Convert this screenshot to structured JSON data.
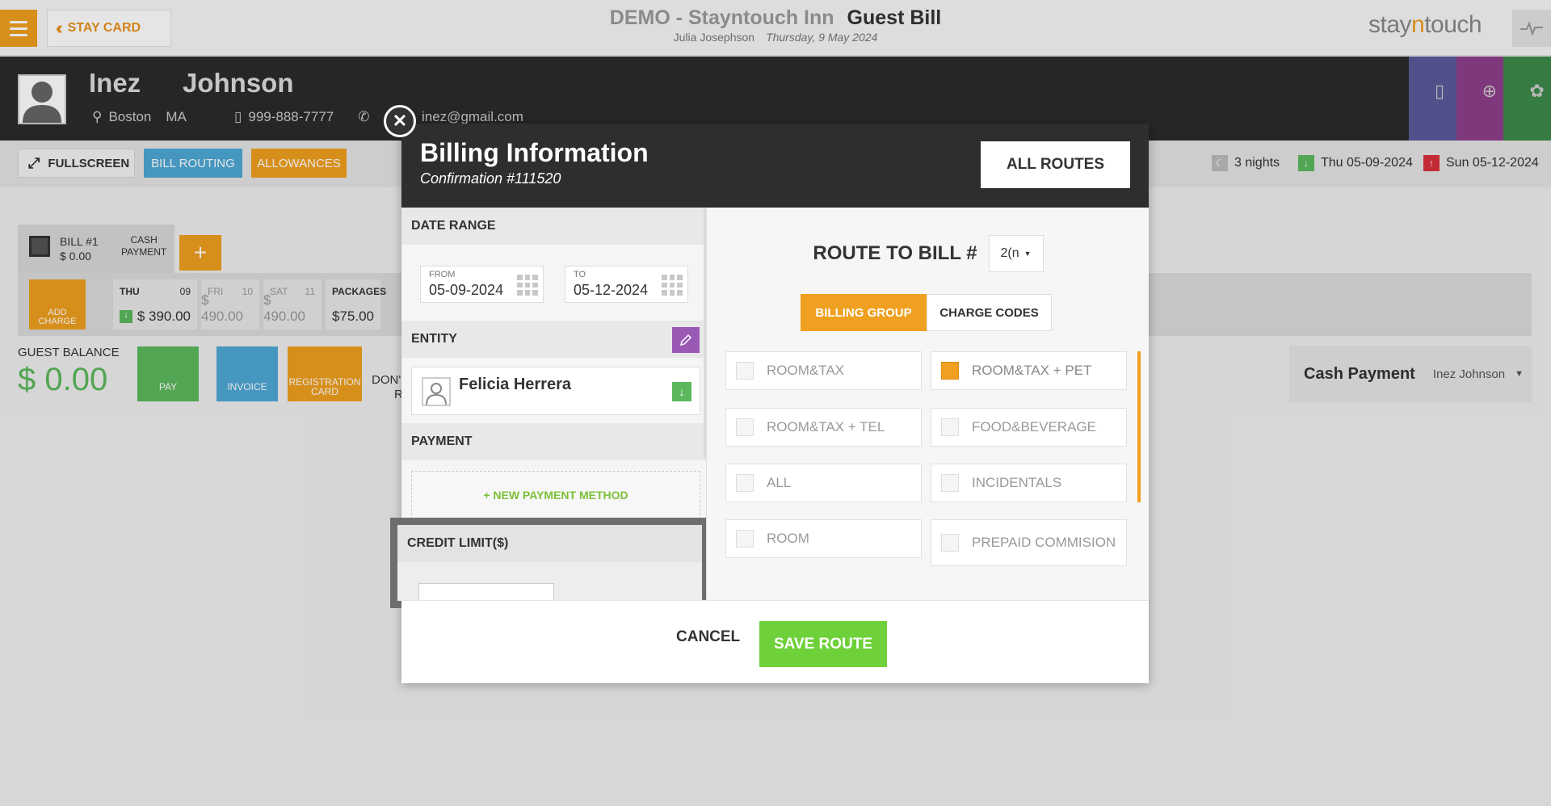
{
  "topbar": {
    "staycard_label": "STAY CARD",
    "hotel": "DEMO - Stayntouch Inn",
    "page": "Guest Bill",
    "user": "Julia Josephson",
    "date": "Thursday, 9 May 2024",
    "logo_a": "stay",
    "logo_b": "n",
    "logo_c": "touch"
  },
  "guest": {
    "first": "Inez",
    "last": "Johnson",
    "city": "Boston",
    "state": "MA",
    "phone": "999-888-7777",
    "email": "inez@gmail.com"
  },
  "subbar": {
    "fullscreen": "FULLSCREEN",
    "bill_routing": "BILL ROUTING",
    "allowances": "ALLOWANCES",
    "nights": "3 nights",
    "arrival": "Thu 05-09-2024",
    "departure": "Sun 05-12-2024"
  },
  "bill": {
    "label": "BILL #1",
    "amount": "$ 0.00",
    "cash_l1": "CASH",
    "cash_l2": "PAYMENT",
    "add_charge_l1": "ADD",
    "add_charge_l2": "CHARGE",
    "days": [
      {
        "day": "THU",
        "num": "09",
        "value": "$ 390.00"
      },
      {
        "day": "FRI",
        "num": "10",
        "value": "$ 490.00"
      },
      {
        "day": "SAT",
        "num": "11",
        "value": "$ 490.00"
      },
      {
        "day": "PACKAGES",
        "num": "",
        "value": "$75.00"
      }
    ],
    "balance_label": "GUEST BALANCE",
    "balance": "$ 0.00",
    "pay": "PAY",
    "invoice": "INVOICE",
    "reg_l1": "REGISTRATION",
    "reg_l2": "CARD",
    "donr_l1": "DON'",
    "donr_l2": "R"
  },
  "cashpanel": {
    "label": "Cash Payment",
    "name": "Inez Johnson"
  },
  "modal": {
    "title": "Billing Information",
    "confirmation": "Confirmation #111520",
    "all_routes": "ALL ROUTES",
    "date_range": "DATE RANGE",
    "from_label": "FROM",
    "from": "05-09-2024",
    "to_label": "TO",
    "to": "05-12-2024",
    "entity": "ENTITY",
    "entity_name": "Felicia Herrera",
    "payment": "PAYMENT",
    "new_payment": "+ NEW PAYMENT METHOD",
    "credit_limit": "CREDIT LIMIT($)",
    "route_to": "ROUTE TO BILL #",
    "route_value": "2(n",
    "billing_group": "BILLING GROUP",
    "charge_codes": "CHARGE CODES",
    "options": [
      {
        "label": "ROOM&TAX",
        "checked": false
      },
      {
        "label": "ROOM&TAX + PET",
        "checked": true
      },
      {
        "label": "ROOM&TAX + TEL",
        "checked": false
      },
      {
        "label": "FOOD&BEVERAGE",
        "checked": false
      },
      {
        "label": "ALL",
        "checked": false
      },
      {
        "label": "INCIDENTALS",
        "checked": false
      },
      {
        "label": "ROOM",
        "checked": false
      },
      {
        "label": "PREPAID COMMISION",
        "checked": false
      }
    ],
    "cancel": "CANCEL",
    "save": "SAVE ROUTE"
  },
  "colors": {
    "accent": "#f0a020",
    "header": "#2b2b2b",
    "blue": "#4fa9d6",
    "green": "#6fd13a",
    "purple": "#9b59b6"
  }
}
